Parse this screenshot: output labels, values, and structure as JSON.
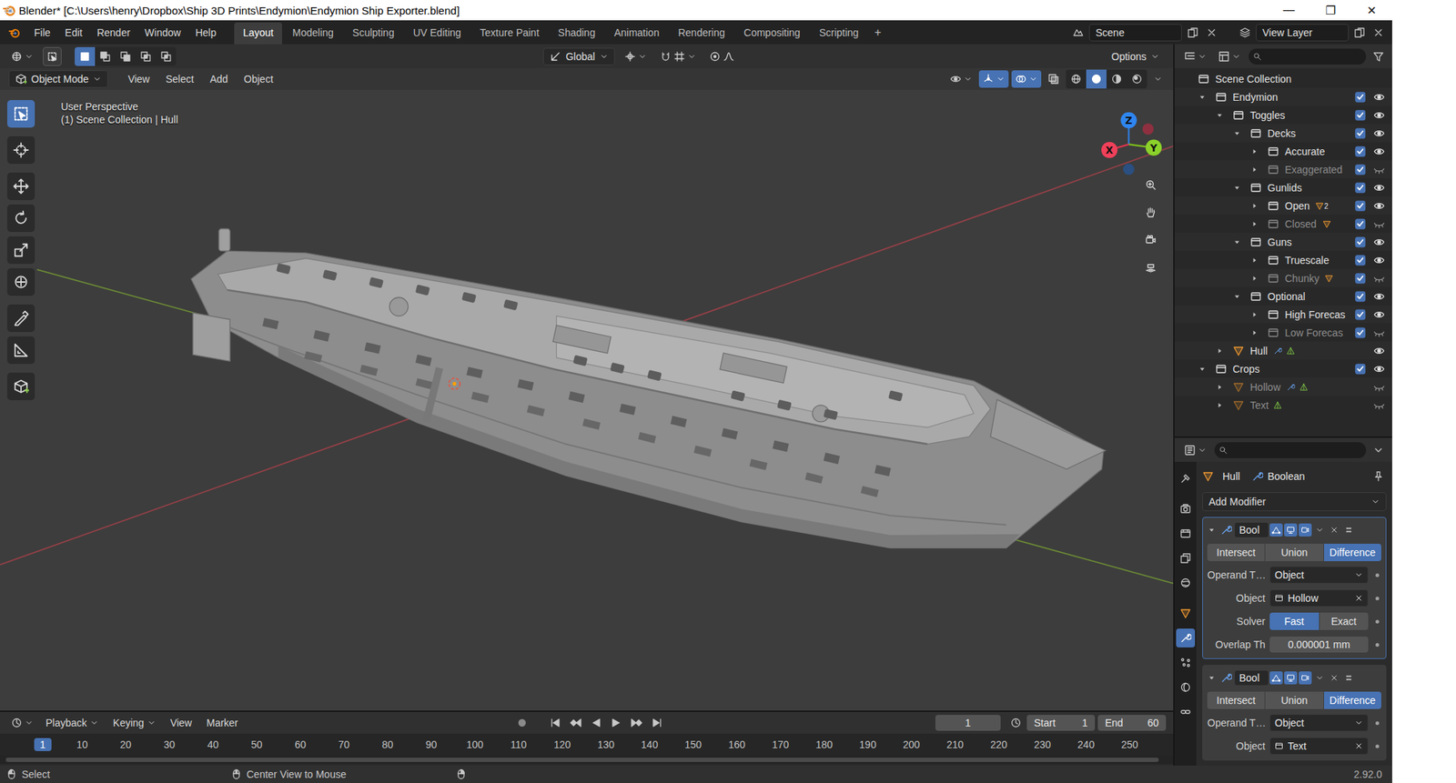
{
  "window": {
    "title": "Blender* [C:\\Users\\henry\\Dropbox\\Ship 3D Prints\\Endymion\\Endymion Ship Exporter.blend]",
    "controls": [
      "—",
      "❐",
      "✕"
    ]
  },
  "menu": [
    "File",
    "Edit",
    "Render",
    "Window",
    "Help"
  ],
  "workspaces": [
    {
      "label": "Layout",
      "selected": true
    },
    {
      "label": "Modeling",
      "selected": false
    },
    {
      "label": "Sculpting",
      "selected": false
    },
    {
      "label": "UV Editing",
      "selected": false
    },
    {
      "label": "Texture Paint",
      "selected": false
    },
    {
      "label": "Shading",
      "selected": false
    },
    {
      "label": "Animation",
      "selected": false
    },
    {
      "label": "Rendering",
      "selected": false
    },
    {
      "label": "Compositing",
      "selected": false
    },
    {
      "label": "Scripting",
      "selected": false
    }
  ],
  "add_workspace": "+",
  "scene": "Scene",
  "view_layer": "View Layer",
  "tool_header": {
    "orientation": "Global",
    "options": "Options",
    "select_modes": [
      {
        "kind": "new",
        "selected": true
      },
      {
        "kind": "add",
        "selected": false
      },
      {
        "kind": "sub",
        "selected": false
      },
      {
        "kind": "invert",
        "selected": false
      },
      {
        "kind": "and",
        "selected": false
      }
    ]
  },
  "viewport": {
    "mode": "Object Mode",
    "menus": [
      "View",
      "Select",
      "Add",
      "Object"
    ],
    "info": [
      "User Perspective",
      "(1) Scene Collection | Hull"
    ],
    "gizmo": {
      "x": "X",
      "y": "Y",
      "z": "Z"
    },
    "toggles": [
      {
        "kind": "gizmo",
        "on": true
      },
      {
        "kind": "overlay",
        "on": true
      },
      {
        "kind": "xray",
        "on": false
      }
    ],
    "shading": [
      {
        "kind": "wire",
        "selected": false
      },
      {
        "kind": "solid",
        "selected": true
      },
      {
        "kind": "material",
        "selected": false
      },
      {
        "kind": "rendered",
        "selected": false
      }
    ],
    "tools": [
      {
        "kind": "select",
        "selected": true
      },
      {
        "kind": "cursor",
        "selected": false
      },
      {
        "kind": "move",
        "selected": false
      },
      {
        "kind": "rotate",
        "selected": false
      },
      {
        "kind": "scale",
        "selected": false
      },
      {
        "kind": "transform",
        "selected": false
      },
      {
        "kind": "annotate",
        "selected": false
      },
      {
        "kind": "measure",
        "selected": false
      },
      {
        "kind": "cube",
        "selected": false
      }
    ]
  },
  "outliner": {
    "items": [
      {
        "name": "Scene Collection",
        "kind": "scene",
        "depth": 0,
        "expanded": true,
        "checked": false,
        "visible": true,
        "greyed": false,
        "has_modifiers": false,
        "child_objects": false
      },
      {
        "name": "Endymion",
        "kind": "collection",
        "depth": 1,
        "expanded": true,
        "checked": true,
        "visible": true,
        "greyed": false,
        "has_modifiers": false,
        "child_objects": false
      },
      {
        "name": "Toggles",
        "kind": "collection",
        "depth": 2,
        "expanded": true,
        "checked": true,
        "visible": true,
        "greyed": false,
        "has_modifiers": false,
        "child_objects": false
      },
      {
        "name": "Decks",
        "kind": "collection",
        "depth": 3,
        "expanded": true,
        "checked": true,
        "visible": true,
        "greyed": false,
        "has_modifiers": false,
        "child_objects": false
      },
      {
        "name": "Accurate",
        "kind": "collection",
        "depth": 4,
        "expanded": false,
        "checked": true,
        "visible": true,
        "greyed": false,
        "has_modifiers": false,
        "child_objects": false
      },
      {
        "name": "Exaggerated",
        "kind": "collection",
        "depth": 4,
        "expanded": false,
        "checked": true,
        "visible": false,
        "greyed": true,
        "has_modifiers": false,
        "child_objects": false
      },
      {
        "name": "Gunlids",
        "kind": "collection",
        "depth": 3,
        "expanded": true,
        "checked": true,
        "visible": true,
        "greyed": false,
        "has_modifiers": false,
        "child_objects": false
      },
      {
        "name": "Open",
        "kind": "collection",
        "depth": 4,
        "expanded": false,
        "checked": true,
        "visible": true,
        "greyed": false,
        "has_modifiers": false,
        "child_objects": true,
        "badge": "2"
      },
      {
        "name": "Closed",
        "kind": "collection",
        "depth": 4,
        "expanded": false,
        "checked": true,
        "visible": false,
        "greyed": true,
        "has_modifiers": false,
        "child_objects": true
      },
      {
        "name": "Guns",
        "kind": "collection",
        "depth": 3,
        "expanded": true,
        "checked": true,
        "visible": true,
        "greyed": false,
        "has_modifiers": false,
        "child_objects": false
      },
      {
        "name": "Truescale",
        "kind": "collection",
        "depth": 4,
        "expanded": false,
        "checked": true,
        "visible": true,
        "greyed": false,
        "has_modifiers": false,
        "child_objects": false
      },
      {
        "name": "Chunky",
        "kind": "collection",
        "depth": 4,
        "expanded": false,
        "checked": true,
        "visible": false,
        "greyed": true,
        "has_modifiers": false,
        "child_objects": true
      },
      {
        "name": "Optional",
        "kind": "collection",
        "depth": 3,
        "expanded": true,
        "checked": true,
        "visible": true,
        "greyed": false,
        "has_modifiers": false,
        "child_objects": false
      },
      {
        "name": "High Forecas",
        "kind": "collection",
        "depth": 4,
        "expanded": false,
        "checked": true,
        "visible": true,
        "greyed": false,
        "has_modifiers": false,
        "child_objects": false
      },
      {
        "name": "Low Forecas",
        "kind": "collection",
        "depth": 4,
        "expanded": false,
        "checked": true,
        "visible": false,
        "greyed": true,
        "has_modifiers": false,
        "child_objects": false
      },
      {
        "name": "Hull",
        "kind": "object",
        "depth": 2,
        "expanded": false,
        "checked": false,
        "visible": true,
        "greyed": false,
        "has_modifiers": true,
        "child_objects": false
      },
      {
        "name": "Crops",
        "kind": "collection",
        "depth": 1,
        "expanded": true,
        "checked": true,
        "visible": true,
        "greyed": false,
        "has_modifiers": false,
        "child_objects": false
      },
      {
        "name": "Hollow",
        "kind": "object",
        "depth": 2,
        "expanded": false,
        "checked": false,
        "visible": false,
        "greyed": true,
        "has_modifiers": true,
        "child_objects": false
      },
      {
        "name": "Text",
        "kind": "object",
        "depth": 2,
        "expanded": false,
        "checked": false,
        "visible": false,
        "greyed": true,
        "has_modifiers": false,
        "child_objects": false
      }
    ]
  },
  "properties": {
    "tabs": [
      {
        "kind": "tool",
        "selected": false
      },
      {
        "kind": "render",
        "selected": false
      },
      {
        "kind": "output",
        "selected": false
      },
      {
        "kind": "viewlayer",
        "selected": false
      },
      {
        "kind": "scene",
        "selected": false
      },
      {
        "kind": "world",
        "selected": false
      },
      {
        "kind": "object",
        "selected": false
      },
      {
        "kind": "modifier",
        "selected": true
      },
      {
        "kind": "particles",
        "selected": false
      },
      {
        "kind": "physics",
        "selected": false
      },
      {
        "kind": "constraints",
        "selected": false
      }
    ],
    "object": "Hull",
    "modifier": "Boolean",
    "add": "Add Modifier",
    "modifiers": [
      {
        "name": "Bool",
        "active": true,
        "expanded": true,
        "show_editmode": true,
        "show_viewport": true,
        "show_render": true,
        "operations": [
          {
            "label": "Intersect",
            "selected": false
          },
          {
            "label": "Union",
            "selected": false
          },
          {
            "label": "Difference",
            "selected": true
          }
        ],
        "fields": [
          {
            "kind": "dropdown",
            "label": "Operand T…",
            "value": "Object"
          },
          {
            "kind": "object",
            "label": "Object",
            "value": "Hollow"
          },
          {
            "kind": "toggle",
            "label": "Solver",
            "options": [
              {
                "label": "Fast",
                "selected": true
              },
              {
                "label": "Exact",
                "selected": false
              }
            ]
          },
          {
            "kind": "number",
            "label": "Overlap Th",
            "value": "0.000001 mm"
          }
        ]
      },
      {
        "name": "Bool",
        "active": false,
        "expanded": true,
        "show_editmode": true,
        "show_viewport": true,
        "show_render": true,
        "operations": [
          {
            "label": "Intersect",
            "selected": false
          },
          {
            "label": "Union",
            "selected": false
          },
          {
            "label": "Difference",
            "selected": true
          }
        ],
        "fields": [
          {
            "kind": "dropdown",
            "label": "Operand T…",
            "value": "Object"
          },
          {
            "kind": "object",
            "label": "Object",
            "value": "Text"
          }
        ]
      }
    ]
  },
  "timeline": {
    "menus": [
      "Playback",
      "Keying",
      "View",
      "Marker"
    ],
    "current": "1",
    "start_label": "Start",
    "start": "1",
    "end_label": "End",
    "end": "60",
    "ruler": [
      {
        "label": "1",
        "selected": true
      },
      {
        "label": "10",
        "selected": false
      },
      {
        "label": "20",
        "selected": false
      },
      {
        "label": "30",
        "selected": false
      },
      {
        "label": "40",
        "selected": false
      },
      {
        "label": "50",
        "selected": false
      },
      {
        "label": "60",
        "selected": false
      },
      {
        "label": "70",
        "selected": false
      },
      {
        "label": "80",
        "selected": false
      },
      {
        "label": "90",
        "selected": false
      },
      {
        "label": "100",
        "selected": false
      },
      {
        "label": "110",
        "selected": false
      },
      {
        "label": "120",
        "selected": false
      },
      {
        "label": "130",
        "selected": false
      },
      {
        "label": "140",
        "selected": false
      },
      {
        "label": "150",
        "selected": false
      },
      {
        "label": "160",
        "selected": false
      },
      {
        "label": "170",
        "selected": false
      },
      {
        "label": "180",
        "selected": false
      },
      {
        "label": "190",
        "selected": false
      },
      {
        "label": "200",
        "selected": false
      },
      {
        "label": "210",
        "selected": false
      },
      {
        "label": "220",
        "selected": false
      },
      {
        "label": "230",
        "selected": false
      },
      {
        "label": "240",
        "selected": false
      },
      {
        "label": "250",
        "selected": false
      }
    ]
  },
  "status_bar": {
    "items": [
      {
        "kind": "left",
        "label": "Select"
      },
      {
        "kind": "middle",
        "label": "Center View to Mouse"
      }
    ],
    "version": "2.92.0"
  }
}
